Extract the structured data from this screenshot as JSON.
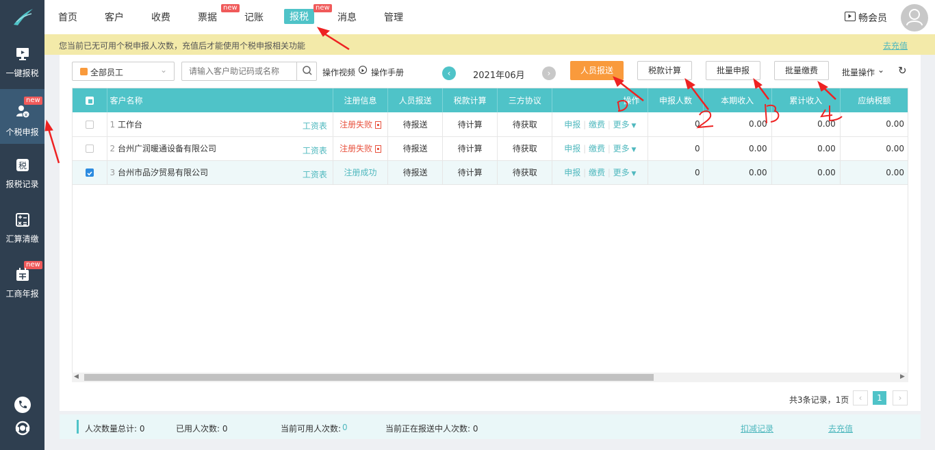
{
  "nav": {
    "items": [
      {
        "label": "首页"
      },
      {
        "label": "客户"
      },
      {
        "label": "收费"
      },
      {
        "label": "票据",
        "badge": "new"
      },
      {
        "label": "记账"
      },
      {
        "label": "报税",
        "badge": "new"
      },
      {
        "label": "消息"
      },
      {
        "label": "管理"
      }
    ],
    "member": "畅会员"
  },
  "notice": {
    "text": "您当前已无可用个税申报人次数，充值后才能使用个税申报相关功能",
    "link": "去充值"
  },
  "sidebar": {
    "items": [
      {
        "label": "一键报税"
      },
      {
        "label": "个税申报",
        "badge": "new"
      },
      {
        "label": "报税记录"
      },
      {
        "label": "汇算清缴"
      },
      {
        "label": "工商年报",
        "badge": "new"
      }
    ]
  },
  "toolbar": {
    "filter_select": "全部员工",
    "search_placeholder": "请输入客户助记码或名称",
    "video_link": "操作视频",
    "manual_link": "操作手册",
    "period": "2021年06月",
    "btn_report": "人员报送",
    "btn_tax_calc": "税款计算",
    "btn_batch_declare": "批量申报",
    "btn_batch_pay": "批量缴费",
    "batch_ops": "批量操作"
  },
  "table": {
    "headers": [
      "客户名称",
      "注册信息",
      "人员报送",
      "税款计算",
      "三方协议",
      "操作",
      "申报人数",
      "本期收入",
      "累计收入",
      "应纳税额"
    ],
    "rows": [
      {
        "idx": "1",
        "name": "工作台",
        "sheet": "工资表",
        "reg": "注册失败",
        "reg_ok": false,
        "report": "待报送",
        "calc": "待计算",
        "agree": "待获取",
        "op1": "申报",
        "op2": "缴费",
        "op3": "更多",
        "count": "0",
        "income": "0.00",
        "cum": "0.00",
        "tax": "0.00",
        "checked": false
      },
      {
        "idx": "2",
        "name": "台州广润暖通设备有限公司",
        "sheet": "工资表",
        "reg": "注册失败",
        "reg_ok": false,
        "report": "待报送",
        "calc": "待计算",
        "agree": "待获取",
        "op1": "申报",
        "op2": "缴费",
        "op3": "更多",
        "count": "0",
        "income": "0.00",
        "cum": "0.00",
        "tax": "0.00",
        "checked": false
      },
      {
        "idx": "3",
        "name": "台州市品汐贸易有限公司",
        "sheet": "工资表",
        "reg": "注册成功",
        "reg_ok": true,
        "report": "待报送",
        "calc": "待计算",
        "agree": "待获取",
        "op1": "申报",
        "op2": "缴费",
        "op3": "更多",
        "count": "0",
        "income": "0.00",
        "cum": "0.00",
        "tax": "0.00",
        "checked": true
      }
    ]
  },
  "pagination": {
    "summary": "共3条记录，1页",
    "page": "1"
  },
  "footer": {
    "total": "人次数量总计: 0",
    "used": "已用人次数: 0",
    "available_label": "当前可用人次数:",
    "available_value": "0",
    "in_progress": "当前正在报送中人次数: 0",
    "deduct_link": "扣减记录",
    "recharge_link": "去充值"
  },
  "colors": {
    "accent": "#4fc3c8",
    "orange": "#f99a3c",
    "sidebar": "#2f3f50",
    "notice": "#f3eaa9",
    "error": "#e8503c"
  }
}
